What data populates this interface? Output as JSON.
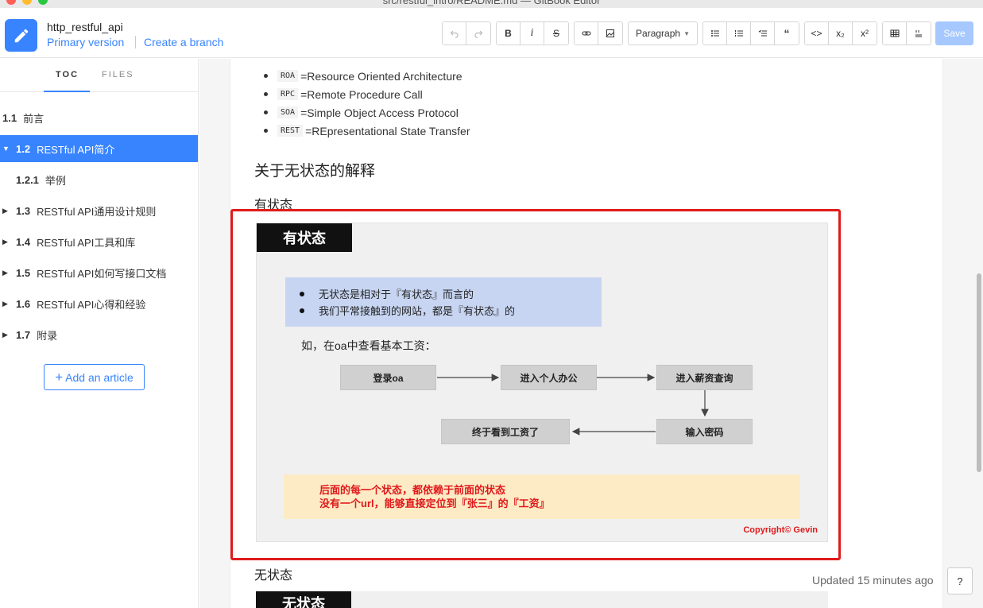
{
  "window": {
    "title": "src/restful_intro/README.md — GitBook Editor"
  },
  "header": {
    "book_title": "http_restful_api",
    "primary_version": "Primary version",
    "create_branch": "Create a branch",
    "save_label": "Save"
  },
  "toolbar": {
    "bold": "B",
    "italic": "i",
    "strike": "S",
    "paragraph": "Paragraph",
    "code": "<>",
    "subscript": "x₂",
    "superscript": "x²"
  },
  "sidebar": {
    "tabs": [
      "TOC",
      "FILES"
    ],
    "items": [
      {
        "num": "1.1",
        "label": "前言",
        "caret": ""
      },
      {
        "num": "1.2",
        "label": "RESTful API简介",
        "caret": "▼"
      },
      {
        "num": "1.2.1",
        "label": "举例",
        "caret": ""
      },
      {
        "num": "1.3",
        "label": "RESTful API通用设计规则",
        "caret": "▶"
      },
      {
        "num": "1.4",
        "label": "RESTful API工具和库",
        "caret": "▶"
      },
      {
        "num": "1.5",
        "label": "RESTful API如何写接口文档",
        "caret": "▶"
      },
      {
        "num": "1.6",
        "label": "RESTful API心得和经验",
        "caret": "▶"
      },
      {
        "num": "1.7",
        "label": "附录",
        "caret": "▶"
      }
    ],
    "add_article": "Add an article"
  },
  "content": {
    "bullets": [
      {
        "code": "ROA",
        "text": "=Resource Oriented Architecture"
      },
      {
        "code": "RPC",
        "text": "=Remote Procedure Call"
      },
      {
        "code": "SOA",
        "text": "=Simple Object Access Protocol"
      },
      {
        "code": "REST",
        "text": "=REpresentational State Transfer"
      }
    ],
    "heading": "关于无状态的解释",
    "sub_stateful": "有状态",
    "sub_stateless": "无状态",
    "slide": {
      "title": "有状态",
      "info": [
        "无状态是相对于『有状态』而言的",
        "我们平常接触到的网站，都是『有状态』的"
      ],
      "intro": "如，在oa中查看基本工资：",
      "flow": [
        "登录oa",
        "进入个人办公",
        "进入薪资查询",
        "输入密码",
        "终于看到工资了"
      ],
      "note": [
        "后面的每一个状态，都依赖于前面的状态",
        "没有一个url，能够直接定位到『张三』的『工资』"
      ],
      "copyright": "Copyright© Gevin"
    },
    "slide2_title": "无状态"
  },
  "footer": {
    "updated": "Updated 15 minutes ago",
    "help": "?"
  },
  "colors": {
    "accent": "#3884ff",
    "highlight": "#e01b1b",
    "note_text": "#e0191b"
  }
}
